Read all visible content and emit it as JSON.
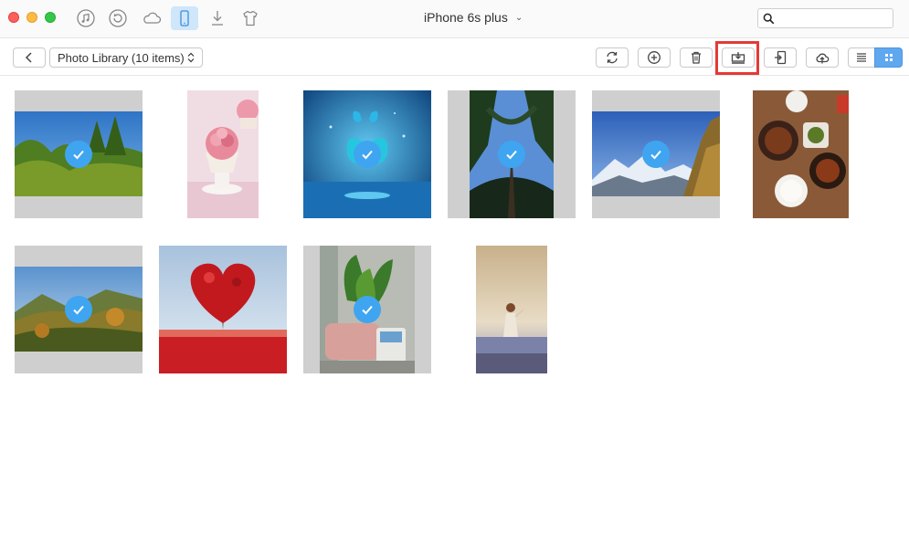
{
  "window": {
    "device_title": "iPhone 6s plus",
    "device_chevron": "⌄",
    "search_placeholder": ""
  },
  "top_icons": [
    "music-icon",
    "sync-restore-icon",
    "cloud-icon",
    "iphone-icon",
    "download-icon",
    "tshirt-icon"
  ],
  "toolbar": {
    "library_label": "Photo Library (10 items)",
    "buttons": [
      "refresh-icon",
      "add-icon",
      "delete-icon",
      "export-to-computer-icon",
      "import-to-device-icon",
      "upload-cloud-icon"
    ],
    "view_modes": [
      "list-view-icon",
      "grid-view-icon"
    ],
    "active_view": "grid"
  },
  "colors": {
    "accent": "#3fa5f0",
    "highlight": "#e53935",
    "tile_gray": "#cfcfcf"
  },
  "photos": [
    {
      "subject": "trees-landscape",
      "selected": true
    },
    {
      "subject": "cupcake-flower",
      "selected": false
    },
    {
      "subject": "blue-butterflies",
      "selected": true
    },
    {
      "subject": "tall-trees-sky",
      "selected": true
    },
    {
      "subject": "snowy-mountains",
      "selected": true
    },
    {
      "subject": "food-table",
      "selected": false
    },
    {
      "subject": "hillside-forest",
      "selected": true
    },
    {
      "subject": "heart-tree",
      "selected": false
    },
    {
      "subject": "office-plant-bag",
      "selected": true
    },
    {
      "subject": "girl-in-field",
      "selected": false
    }
  ]
}
